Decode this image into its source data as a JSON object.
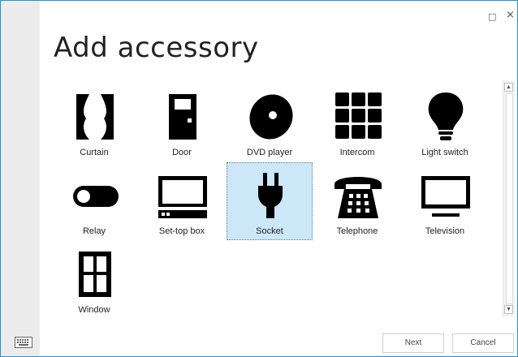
{
  "window": {
    "title": "Add accessory",
    "restore_glyph": "□",
    "close_glyph": "×"
  },
  "accessories": [
    {
      "label": "Curtain",
      "icon": "curtain-icon"
    },
    {
      "label": "Door",
      "icon": "door-icon"
    },
    {
      "label": "DVD player",
      "icon": "dvd-icon"
    },
    {
      "label": "Intercom",
      "icon": "intercom-icon"
    },
    {
      "label": "Light switch",
      "icon": "lightbulb-icon"
    },
    {
      "label": "Relay",
      "icon": "toggle-icon"
    },
    {
      "label": "Set-top box",
      "icon": "set-top-box-icon"
    },
    {
      "label": "Socket",
      "icon": "plug-icon",
      "selected": true
    },
    {
      "label": "Telephone",
      "icon": "telephone-icon"
    },
    {
      "label": "Television",
      "icon": "television-icon"
    },
    {
      "label": "Window",
      "icon": "window-icon"
    }
  ],
  "scrollbar": {
    "up_glyph": "▲",
    "down_glyph": "▼"
  },
  "footer": {
    "next_label": "Next",
    "cancel_label": "Cancel"
  },
  "colors": {
    "accent": "#2a8fd6",
    "selected_bg": "#cce8f8",
    "icon": "#000000"
  }
}
